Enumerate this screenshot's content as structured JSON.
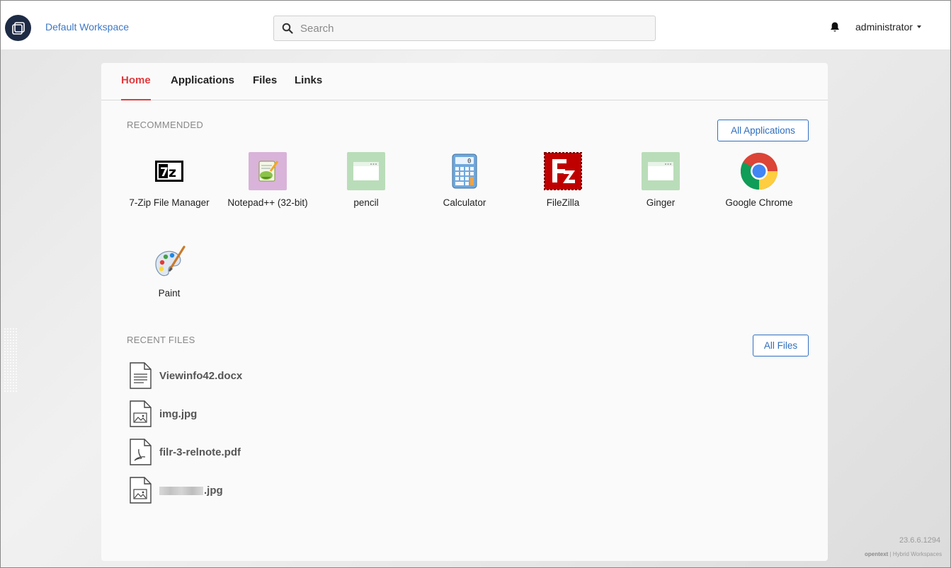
{
  "header": {
    "workspace_name": "Default Workspace",
    "search_placeholder": "Search",
    "user_name": "administrator"
  },
  "tabs": [
    {
      "label": "Home",
      "active": true
    },
    {
      "label": "Applications",
      "active": false
    },
    {
      "label": "Files",
      "active": false
    },
    {
      "label": "Links",
      "active": false
    }
  ],
  "recommended": {
    "title": "RECOMMENDED",
    "all_button": "All Applications",
    "apps": [
      {
        "label": "7-Zip File Manager",
        "icon": "7zip-icon"
      },
      {
        "label": "Notepad++ (32-bit)",
        "icon": "notepad-plus-plus-icon"
      },
      {
        "label": "pencil",
        "icon": "app-window-icon"
      },
      {
        "label": "Calculator",
        "icon": "calculator-icon"
      },
      {
        "label": "FileZilla",
        "icon": "filezilla-icon"
      },
      {
        "label": "Ginger",
        "icon": "app-window-icon"
      },
      {
        "label": "Google Chrome",
        "icon": "chrome-icon"
      },
      {
        "label": "Paint",
        "icon": "paint-palette-icon"
      }
    ]
  },
  "recent_files": {
    "title": "RECENT FILES",
    "all_button": "All Files",
    "files": [
      {
        "name": "Viewinfo42.docx",
        "icon": "document-icon"
      },
      {
        "name": "img.jpg",
        "icon": "image-file-icon"
      },
      {
        "name": "filr-3-relnote.pdf",
        "icon": "pdf-file-icon"
      },
      {
        "name": ".jpg",
        "icon": "image-file-icon",
        "name_partially_obscured": true
      }
    ]
  },
  "footer": {
    "version": "23.6.6.1294",
    "brand_name": "opentext",
    "brand_product": "Hybrid Workspaces"
  },
  "colors": {
    "accent_red": "#e03a3e",
    "link_blue": "#2f6fbf",
    "logo_navy": "#1d2b45"
  }
}
